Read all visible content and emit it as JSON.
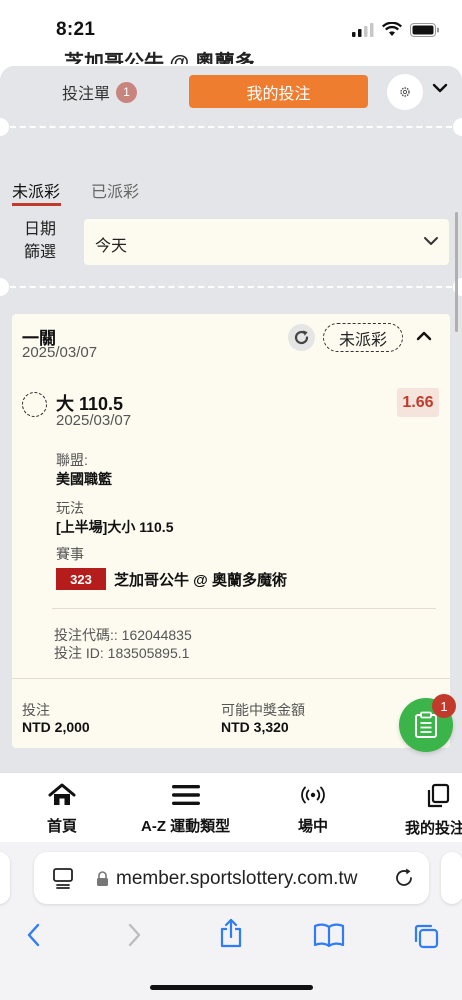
{
  "status_bar": {
    "time": "8:21"
  },
  "background": {
    "peek_text": "芝加哥公牛 @ 奧蘭多"
  },
  "sheet": {
    "tabs": {
      "betslip_label": "投注單",
      "betslip_count": "1",
      "my_bets_label": "我的投注"
    },
    "subtabs": {
      "unsettled": "未派彩",
      "settled": "已派彩"
    },
    "date_filter": {
      "label": "日期篩選",
      "value": "今天"
    }
  },
  "bet_card": {
    "type": "一關",
    "date": "2025/03/07",
    "status": "未派彩",
    "selection": "大 110.5",
    "selection_date": "2025/03/07",
    "odds": "1.66",
    "league_label": "聯盟:",
    "league_value": "美國職籃",
    "market_label": "玩法",
    "market_value": "[上半場]大小 110.5",
    "event_label": "賽事",
    "event_number": "323",
    "event_name": "芝加哥公牛 @ 奧蘭多魔術",
    "bet_code": "投注代碼:: 162044835",
    "bet_id": "投注 ID: 183505895.1",
    "stake_label": "投注",
    "stake_value": "NTD 2,000",
    "payout_label": "可能中獎金額",
    "payout_value": "NTD 3,320"
  },
  "fab": {
    "badge": "1"
  },
  "bottom_nav": [
    {
      "label": "首頁",
      "icon": "home-icon"
    },
    {
      "label": "A-Z 運動類型",
      "icon": "menu-icon"
    },
    {
      "label": "場中",
      "icon": "live-icon"
    },
    {
      "label": "我的投注",
      "icon": "copy-icon"
    }
  ],
  "browser": {
    "url": "member.sportslottery.com.tw"
  },
  "colors": {
    "accent": "#ee7d2f",
    "red": "#c23a2b",
    "green": "#3bb54a",
    "event_badge": "#b51d1d"
  }
}
